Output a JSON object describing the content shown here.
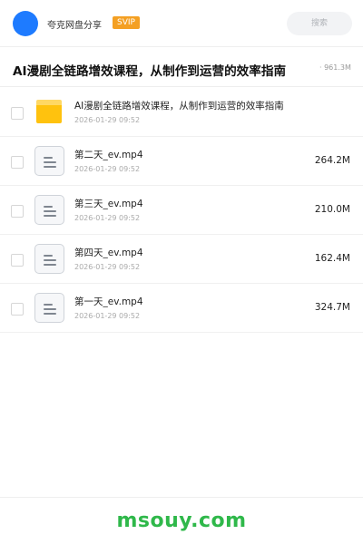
{
  "header": {
    "share_name": "夸克网盘分享",
    "badge": "SVIP",
    "search_placeholder": "搜索"
  },
  "title_bar": {
    "title": "AI漫剧全链路增效课程，从制作到运营的效率指南",
    "total_size": "· 961.3M"
  },
  "files": [
    {
      "type": "folder",
      "name": "AI漫剧全链路增效课程，从制作到运营的效率指南",
      "date": "2026-01-29 09:52",
      "size": ""
    },
    {
      "type": "file",
      "name": "第二天_ev.mp4",
      "date": "2026-01-29 09:52",
      "size": "264.2M"
    },
    {
      "type": "file",
      "name": "第三天_ev.mp4",
      "date": "2026-01-29 09:52",
      "size": "210.0M"
    },
    {
      "type": "file",
      "name": "第四天_ev.mp4",
      "date": "2026-01-29 09:52",
      "size": "162.4M"
    },
    {
      "type": "file",
      "name": "第一天_ev.mp4",
      "date": "2026-01-29 09:52",
      "size": "324.7M"
    }
  ],
  "footer": {
    "watermark": "msouy.com"
  },
  "colors": {
    "accent": "#1e7bff",
    "svip": "#f4a023",
    "folder": "#ffc20e",
    "watermark": "#2fb84a"
  }
}
